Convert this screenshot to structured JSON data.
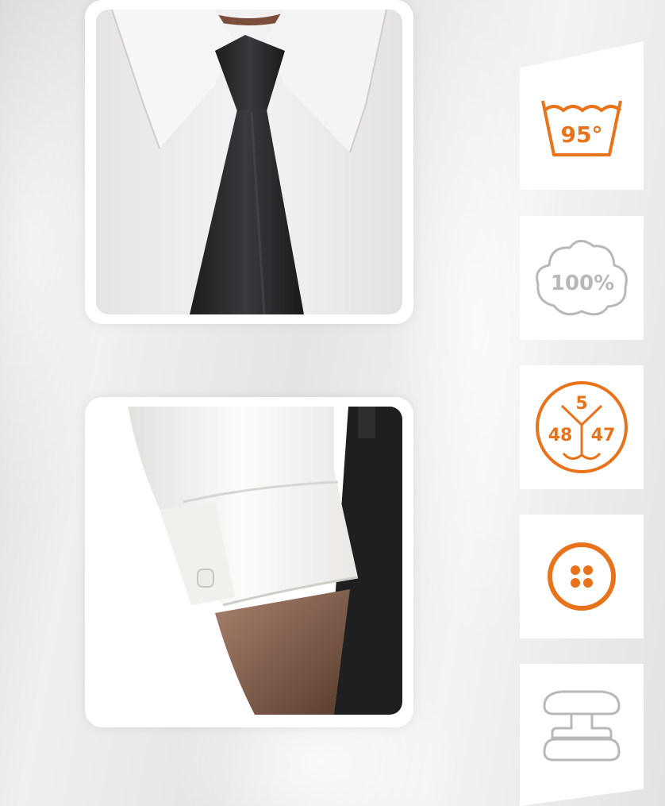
{
  "photos": [
    {
      "name": "collar-tie-photo",
      "subject": "white shirt collar with black tie"
    },
    {
      "name": "cuff-photo",
      "subject": "white shirt cuff with cufflink"
    }
  ],
  "features": {
    "wash": {
      "icon": "wash-basin-icon",
      "label": "95°"
    },
    "cotton": {
      "icon": "cotton-ball-icon",
      "label": "100%"
    },
    "sizes": {
      "icon": "shirt-sizes-icon",
      "top": "5",
      "left": "48",
      "right": "47"
    },
    "button": {
      "icon": "button-icon"
    },
    "cufflink": {
      "icon": "cufflink-icon"
    }
  },
  "colors": {
    "accent": "#e8731b",
    "grey_icon": "#b8b8b8",
    "tile_bg": "#ffffff"
  }
}
